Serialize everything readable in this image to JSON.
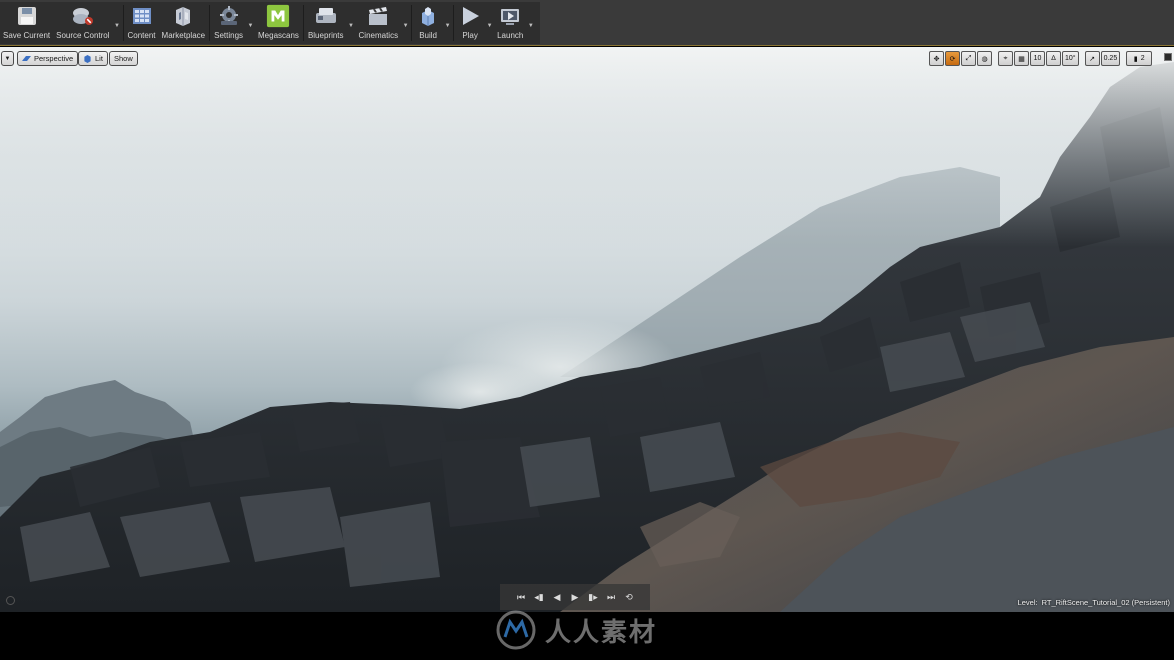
{
  "toolbar": {
    "buttons": [
      {
        "label": "Save Current",
        "icon": "save-icon"
      },
      {
        "label": "Source Control",
        "icon": "source-control-icon"
      },
      {
        "label": "Content",
        "icon": "content-icon"
      },
      {
        "label": "Marketplace",
        "icon": "marketplace-icon"
      },
      {
        "label": "Settings",
        "icon": "settings-icon"
      },
      {
        "label": "Megascans",
        "icon": "megascans-icon"
      },
      {
        "label": "Blueprints",
        "icon": "blueprints-icon"
      },
      {
        "label": "Cinematics",
        "icon": "cinematics-icon"
      },
      {
        "label": "Build",
        "icon": "build-icon"
      },
      {
        "label": "Play",
        "icon": "play-icon"
      },
      {
        "label": "Launch",
        "icon": "launch-icon"
      }
    ]
  },
  "viewport": {
    "perspective_label": "Perspective",
    "lit_label": "Lit",
    "show_label": "Show",
    "grid_snap_value": "10",
    "rotation_snap_value": "10°",
    "scale_snap_value": "0.25",
    "camera_speed_value": "2",
    "level_prefix": "Level:",
    "level_name": "RT_RiftScene_Tutorial_02 (Persistent)"
  },
  "watermark": {
    "text": "人人素材"
  },
  "colors": {
    "accent_orange": "#d9822b",
    "megascans_green": "#8dc63f",
    "toolbar_bg": "#2e2e2e"
  }
}
